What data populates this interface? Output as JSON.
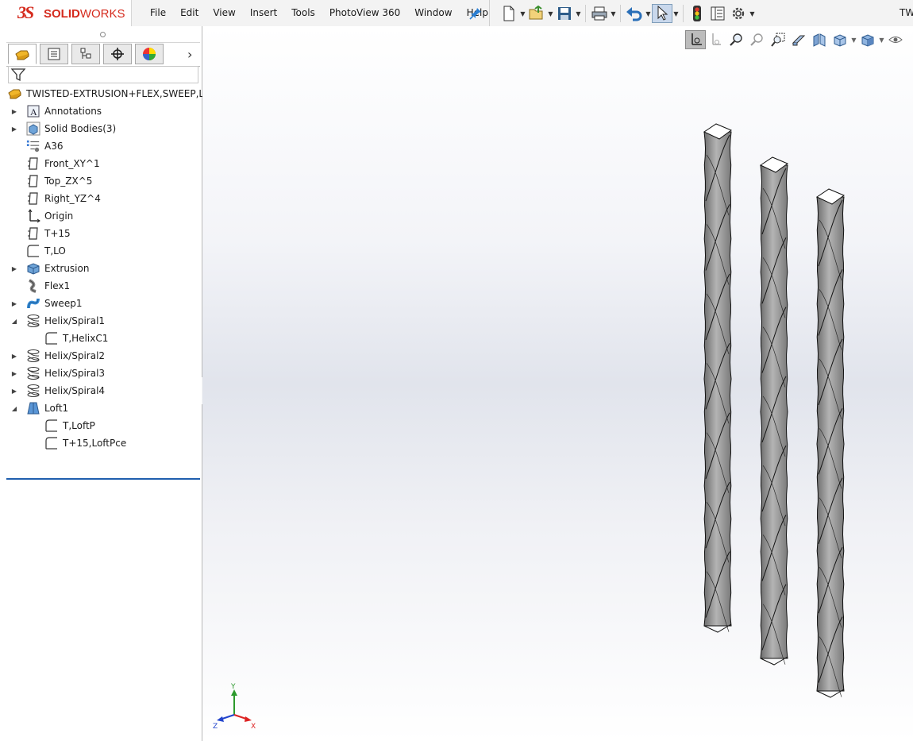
{
  "app": {
    "logo_ds": "3S",
    "logo_solid": "SOLID",
    "logo_works": "WORKS",
    "brand_color": "#d52b1e"
  },
  "menu": [
    "File",
    "Edit",
    "View",
    "Insert",
    "Tools",
    "PhotoView 360",
    "Window",
    "Help"
  ],
  "document_title": "TW",
  "toolbar": {
    "icons": [
      "new-document-icon",
      "open-icon",
      "save-icon",
      "print-icon",
      "undo-icon",
      "select-icon",
      "rebuild-icon",
      "file-properties-icon",
      "options-icon"
    ]
  },
  "feature_manager": {
    "tabs": [
      "feature-manager-tab",
      "property-manager-tab",
      "configuration-manager-tab",
      "dimxpert-tab",
      "display-manager-tab"
    ],
    "root": "TWISTED-EXTRUSION+FLEX,SWEEP,LOFT",
    "items": [
      {
        "label": "Annotations",
        "icon": "annotations-icon",
        "expander": "collapsed",
        "indent": 0
      },
      {
        "label": "Solid Bodies(3)",
        "icon": "solid-bodies-icon",
        "expander": "collapsed",
        "indent": 0
      },
      {
        "label": "A36",
        "icon": "material-icon",
        "expander": "none",
        "indent": 0
      },
      {
        "label": "Front_XY^1",
        "icon": "plane-icon",
        "expander": "none",
        "indent": 0
      },
      {
        "label": "Top_ZX^5",
        "icon": "plane-icon",
        "expander": "none",
        "indent": 0
      },
      {
        "label": "Right_YZ^4",
        "icon": "plane-icon",
        "expander": "none",
        "indent": 0
      },
      {
        "label": "Origin",
        "icon": "origin-icon",
        "expander": "none",
        "indent": 0
      },
      {
        "label": "T+15",
        "icon": "plane-icon",
        "expander": "none",
        "indent": 0
      },
      {
        "label": "T,LO",
        "icon": "sketch-icon",
        "expander": "none",
        "indent": 0
      },
      {
        "label": "Extrusion",
        "icon": "extrude-icon",
        "expander": "collapsed",
        "indent": 0
      },
      {
        "label": "Flex1",
        "icon": "flex-icon",
        "expander": "none",
        "indent": 0
      },
      {
        "label": "Sweep1",
        "icon": "sweep-icon",
        "expander": "collapsed",
        "indent": 0
      },
      {
        "label": "Helix/Spiral1",
        "icon": "helix-icon",
        "expander": "expanded",
        "indent": 0
      },
      {
        "label": "T,HelixC1",
        "icon": "sketch-icon",
        "expander": "none",
        "indent": 1
      },
      {
        "label": "Helix/Spiral2",
        "icon": "helix-icon",
        "expander": "collapsed",
        "indent": 0
      },
      {
        "label": "Helix/Spiral3",
        "icon": "helix-icon",
        "expander": "collapsed",
        "indent": 0
      },
      {
        "label": "Helix/Spiral4",
        "icon": "helix-icon",
        "expander": "collapsed",
        "indent": 0
      },
      {
        "label": "Loft1",
        "icon": "loft-icon",
        "expander": "expanded",
        "indent": 0
      },
      {
        "label": "T,LoftP",
        "icon": "sketch-icon",
        "expander": "none",
        "indent": 1
      },
      {
        "label": "T+15,LoftPce",
        "icon": "sketch-icon",
        "expander": "none",
        "indent": 1
      }
    ]
  },
  "headsup_toolbar": {
    "icons": [
      "temporary-axes-icon",
      "view-origins-icon",
      "zoom-to-fit-icon",
      "zoom-to-area-icon",
      "previous-view-icon",
      "section-view-icon",
      "dynamic-annotation-views-icon",
      "view-orientation-icon",
      "display-style-icon",
      "hide-show-items-icon"
    ]
  },
  "triad": {
    "x": "X",
    "y": "Y",
    "z": "Z"
  },
  "model": {
    "bodies": 3,
    "body_color": "#8a8a8a"
  }
}
